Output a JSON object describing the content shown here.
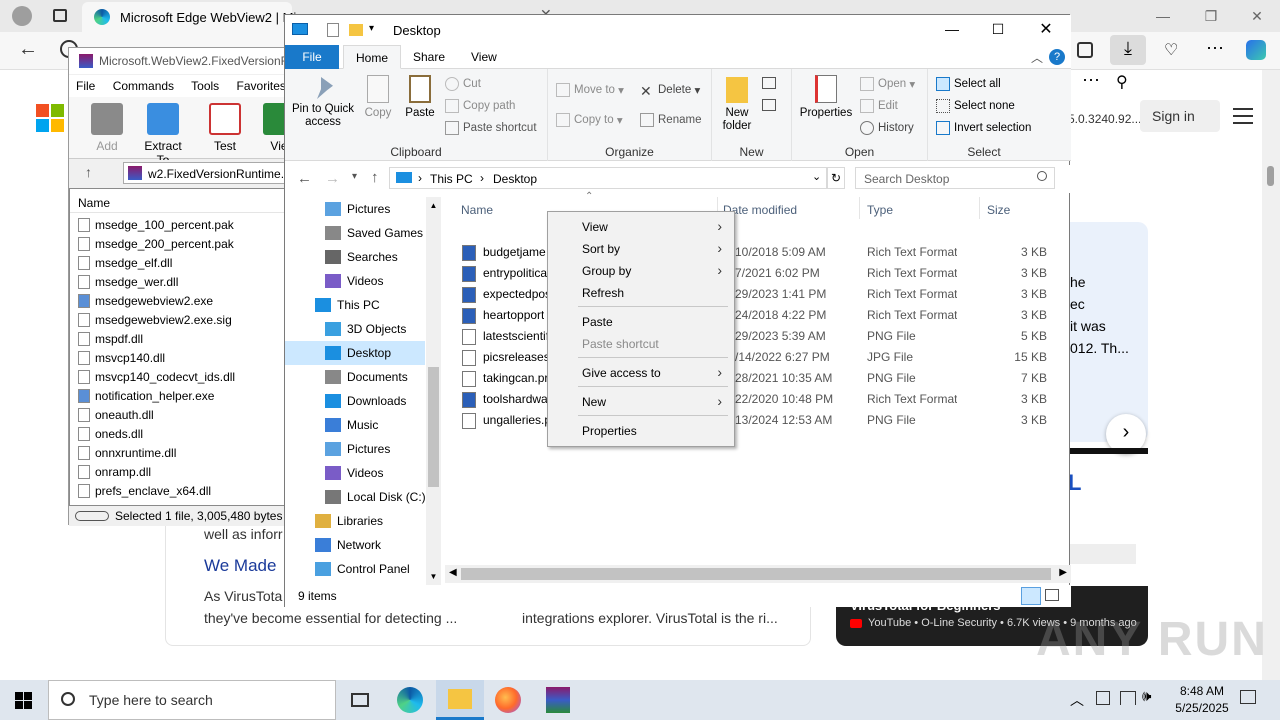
{
  "browser": {
    "tab_title": "Microsoft Edge WebView2 | Mi",
    "tab2_partial": "",
    "sign_in": "Sign in",
    "version_partial": "5.0.3240.92...",
    "snippet_lines": [
      "he",
      "ec",
      "it was",
      "012. Th..."
    ],
    "we_made": "We Made",
    "well_as": "well as inforr",
    "as_vt": "As VirusTota",
    "essential": "they've become essential for detecting ...",
    "integrations": "integrations explorer. VirusTotal is the ri...",
    "video_title": "VirusTotal for Beginners",
    "video_meta": "YouTube • O-Line Security • 6.7K views • 9 months ago",
    "letter_l": "L"
  },
  "winrar": {
    "title": "Microsoft.WebView2.FixedVersionR",
    "menu": [
      "File",
      "Commands",
      "Tools",
      "Favorites"
    ],
    "toolbar": [
      "Add",
      "Extract To",
      "Test",
      "Vie"
    ],
    "path": "w2.FixedVersionRuntime.",
    "col_name": "Name",
    "files": [
      "msedge_100_percent.pak",
      "msedge_200_percent.pak",
      "msedge_elf.dll",
      "msedge_wer.dll",
      "msedgewebview2.exe",
      "msedgewebview2.exe.sig",
      "mspdf.dll",
      "msvcp140.dll",
      "msvcp140_codecvt_ids.dll",
      "notification_helper.exe",
      "oneauth.dll",
      "oneds.dll",
      "onnxruntime.dll",
      "onramp.dll",
      "prefs_enclave_x64.dll"
    ],
    "status": "Selected 1 file, 3,005,480 bytes"
  },
  "explorer": {
    "title": "Desktop",
    "tabs": [
      "File",
      "Home",
      "Share",
      "View"
    ],
    "clipboard": {
      "pin": "Pin to Quick access",
      "copy": "Copy",
      "paste": "Paste",
      "cut": "Cut",
      "copy_path": "Copy path",
      "paste_shortcut": "Paste shortcut",
      "label": "Clipboard"
    },
    "organize": {
      "move_to": "Move to",
      "copy_to": "Copy to",
      "delete": "Delete",
      "rename": "Rename",
      "label": "Organize"
    },
    "new": {
      "new_folder": "New folder",
      "label": "New"
    },
    "open": {
      "properties": "Properties",
      "open": "Open",
      "edit": "Edit",
      "history": "History",
      "label": "Open"
    },
    "select": {
      "select_all": "Select all",
      "select_none": "Select none",
      "invert": "Invert selection",
      "label": "Select"
    },
    "breadcrumb": [
      "This PC",
      "Desktop"
    ],
    "search_placeholder": "Search Desktop",
    "tree": [
      "Pictures",
      "Saved Games",
      "Searches",
      "Videos",
      "This PC",
      "3D Objects",
      "Desktop",
      "Documents",
      "Downloads",
      "Music",
      "Pictures",
      "Videos",
      "Local Disk (C:)",
      "Libraries",
      "Network",
      "Control Panel"
    ],
    "columns": {
      "name": "Name",
      "date": "Date modified",
      "type": "Type",
      "size": "Size"
    },
    "files": [
      {
        "name": "budgetjame",
        "date": "10/2018 5:09 AM",
        "type": "Rich Text Format",
        "size": "3 KB",
        "kind": "rtf"
      },
      {
        "name": "entrypolitica",
        "date": "7/2021 6:02 PM",
        "type": "Rich Text Format",
        "size": "3 KB",
        "kind": "rtf"
      },
      {
        "name": "expectedpos",
        "date": "29/2023 1:41 PM",
        "type": "Rich Text Format",
        "size": "3 KB",
        "kind": "rtf"
      },
      {
        "name": "heartopport",
        "date": "24/2018 4:22 PM",
        "type": "Rich Text Format",
        "size": "3 KB",
        "kind": "rtf"
      },
      {
        "name": "latestscientif",
        "date": "29/2023 5:39 AM",
        "type": "PNG File",
        "size": "5 KB",
        "kind": "img"
      },
      {
        "name": "picsreleases.",
        "date": "/14/2022 6:27 PM",
        "type": "JPG File",
        "size": "15 KB",
        "kind": "img"
      },
      {
        "name": "takingcan.pr",
        "date": "28/2021 10:35 AM",
        "type": "PNG File",
        "size": "7 KB",
        "kind": "img"
      },
      {
        "name": "toolshardwa",
        "date": "22/2020 10:48 PM",
        "type": "Rich Text Format",
        "size": "3 KB",
        "kind": "rtf"
      },
      {
        "name": "ungalleries.p",
        "date": "13/2024 12:53 AM",
        "type": "PNG File",
        "size": "3 KB",
        "kind": "img"
      }
    ],
    "status": "9 items"
  },
  "context_menu": {
    "items": [
      {
        "label": "View",
        "sub": true,
        "disabled": false
      },
      {
        "label": "Sort by",
        "sub": true,
        "disabled": false
      },
      {
        "label": "Group by",
        "sub": true,
        "disabled": false
      },
      {
        "label": "Refresh",
        "sub": false,
        "disabled": false
      },
      {
        "label": "Paste",
        "sub": false,
        "disabled": false
      },
      {
        "label": "Paste shortcut",
        "sub": false,
        "disabled": true
      },
      {
        "label": "Give access to",
        "sub": true,
        "disabled": false
      },
      {
        "label": "New",
        "sub": true,
        "disabled": false
      },
      {
        "label": "Properties",
        "sub": false,
        "disabled": false
      }
    ]
  },
  "taskbar": {
    "search_placeholder": "Type here to search",
    "time": "8:48 AM",
    "date": "5/25/2025"
  },
  "watermark": "ANY RUN"
}
